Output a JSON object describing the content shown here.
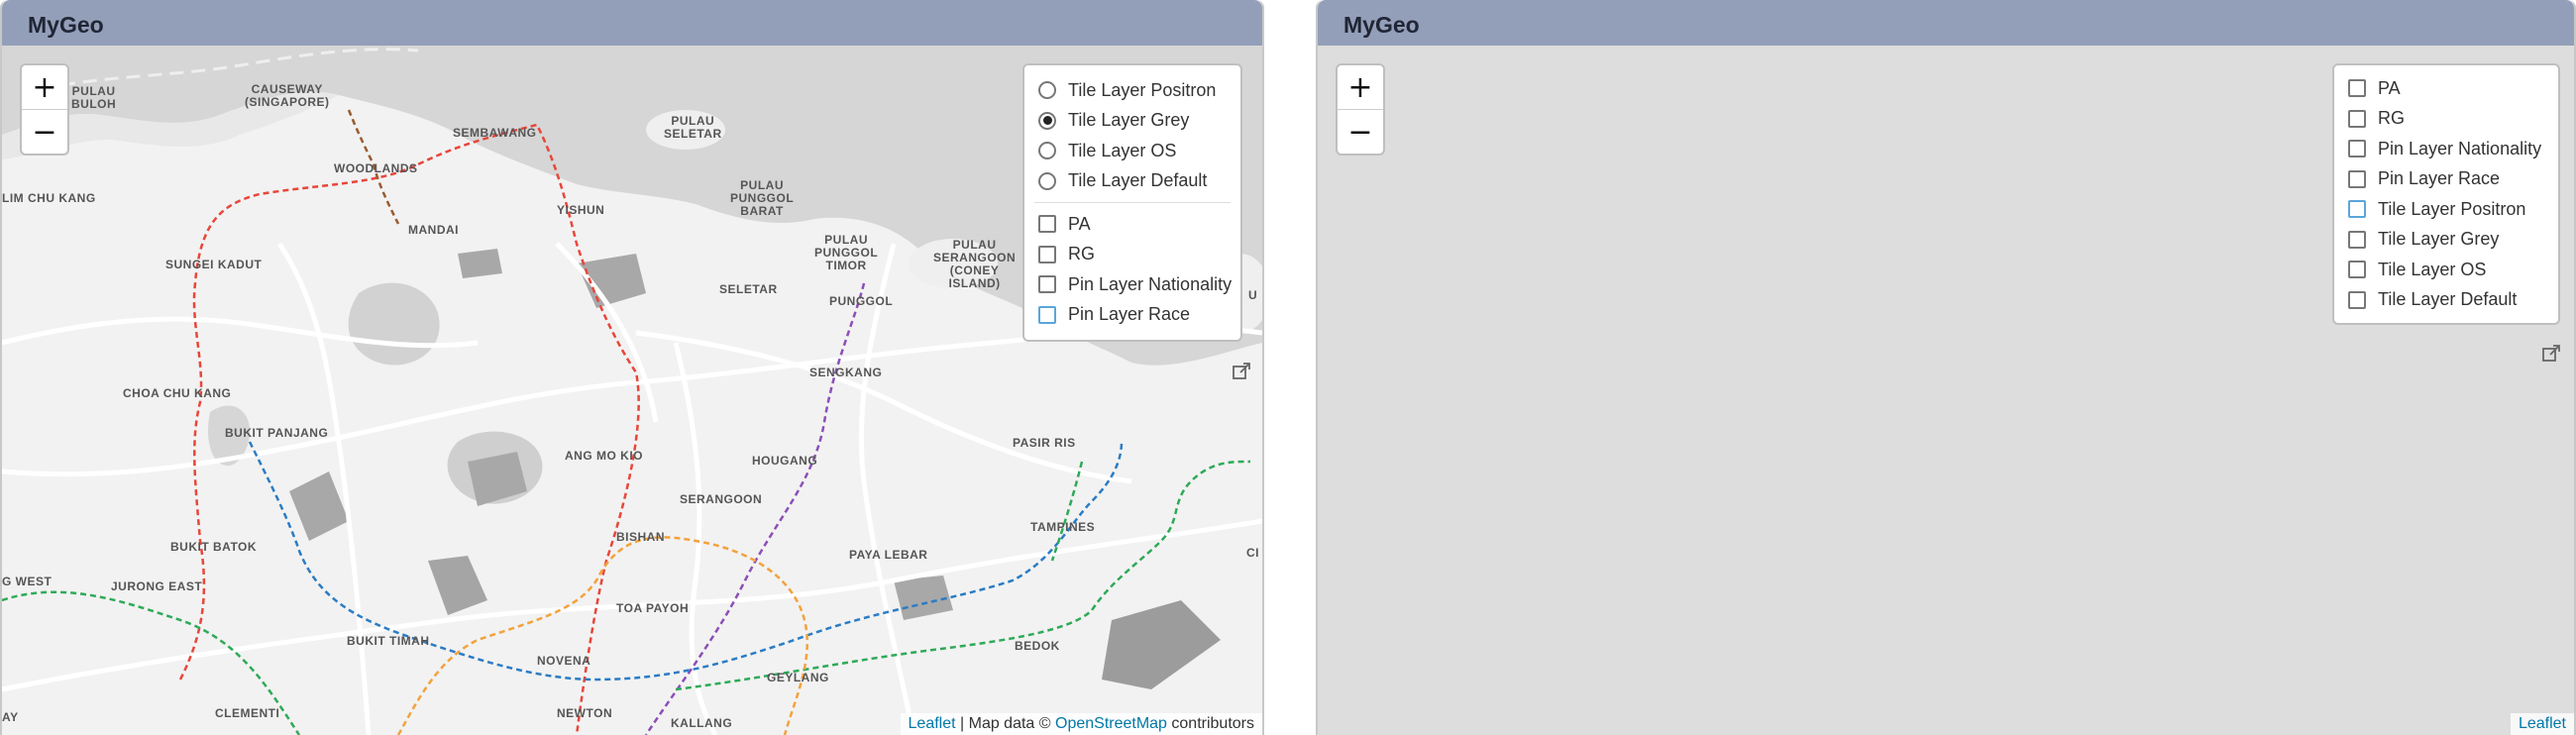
{
  "left_panel": {
    "title": "MyGeo",
    "zoom": {
      "in_label": "+",
      "out_label": "−"
    },
    "base_layers": [
      {
        "label": "Tile Layer Positron",
        "selected": false
      },
      {
        "label": "Tile Layer Grey",
        "selected": true
      },
      {
        "label": "Tile Layer OS",
        "selected": false
      },
      {
        "label": "Tile Layer Default",
        "selected": false
      }
    ],
    "overlays": [
      {
        "label": "PA",
        "checked": false
      },
      {
        "label": "RG",
        "checked": false
      },
      {
        "label": "Pin Layer Nationality",
        "checked": false
      },
      {
        "label": "Pin Layer Race",
        "checked": false
      }
    ],
    "attribution": {
      "leaflet": "Leaflet",
      "separator": " | Map data © ",
      "osm": "OpenStreetMap",
      "suffix": " contributors"
    },
    "popout_icon": "external-link-icon",
    "map_labels": [
      "PULAU\nBULOH",
      "CAUSEWAY\n(SINGAPORE)",
      "SEMBAWANG",
      "PULAU\nSELETAR",
      "WOODLANDS",
      "LIM CHU KANG",
      "YISHUN",
      "PULAU\nPUNGGOL\nBARAT",
      "MANDAI",
      "PULAU\nPUNGGOL\nTIMOR",
      "PULAU\nSERANGOON\n(CONEY\nISLAND)",
      "SUNGEI KADUT",
      "SELETAR",
      "PUNGGOL",
      "SENGKANG",
      "CHOA CHU KANG",
      "BUKIT PANJANG",
      "ANG MO KIO",
      "HOUGANG",
      "PASIR RIS",
      "SERANGOON",
      "TAMPINES",
      "BUKIT BATOK",
      "BISHAN",
      "PAYA LEBAR",
      "G WEST",
      "JURONG EAST",
      "TOA PAYOH",
      "BUKIT TIMAH",
      "BEDOK",
      "NOVENA",
      "GEYLANG",
      "CLEMENTI",
      "NEWTON",
      "KALLANG",
      "AY",
      "CI",
      "U"
    ]
  },
  "right_panel": {
    "title": "MyGeo",
    "zoom": {
      "in_label": "+",
      "out_label": "−"
    },
    "overlays": [
      {
        "label": "PA",
        "checked": false
      },
      {
        "label": "RG",
        "checked": false
      },
      {
        "label": "Pin Layer Nationality",
        "checked": false
      },
      {
        "label": "Pin Layer Race",
        "checked": false
      },
      {
        "label": "Tile Layer Positron",
        "checked": false
      },
      {
        "label": "Tile Layer Grey",
        "checked": false
      },
      {
        "label": "Tile Layer OS",
        "checked": false
      },
      {
        "label": "Tile Layer Default",
        "checked": false
      }
    ],
    "attribution": {
      "leaflet": "Leaflet"
    },
    "popout_icon": "external-link-icon"
  },
  "colors": {
    "titlebar": "#939fb9",
    "map_grey": "#f2f2f2",
    "map_blank": "#dddddd",
    "water": "#d4d4d4",
    "link": "#0078a8",
    "mrt_red": "#e8463a",
    "mrt_purple": "#8c4fb8",
    "mrt_blue": "#2b7cc4",
    "mrt_green": "#2eaa58",
    "mrt_orange": "#f3a23c",
    "mrt_brown": "#9a5b2f"
  }
}
